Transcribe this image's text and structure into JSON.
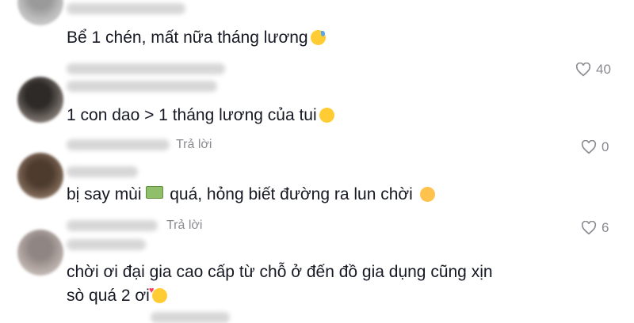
{
  "comments": [
    {
      "text": "Bể 1 chén, mất nữa tháng lương",
      "emoji": "sweat-smile-emoji",
      "likes": "40"
    },
    {
      "text": "1 con dao > 1 tháng lương của tui",
      "emoji": "pleading-face-emoji",
      "reply": "Trả lời",
      "likes": "0"
    },
    {
      "text_before": "bị say mùi",
      "text": "quá, hỏng biết đường ra lun chời",
      "inline_emoji": "money-emoji",
      "emoji": "flushed-face-emoji",
      "reply": "Trả lời",
      "likes": "6"
    },
    {
      "text_line1": "chời ơi đại gia cao cấp từ chỗ ở đến đồ gia dụng cũng xịn",
      "text_line2": "sò quá 2 ơi",
      "emoji": "smiling-hearts-emoji"
    }
  ]
}
